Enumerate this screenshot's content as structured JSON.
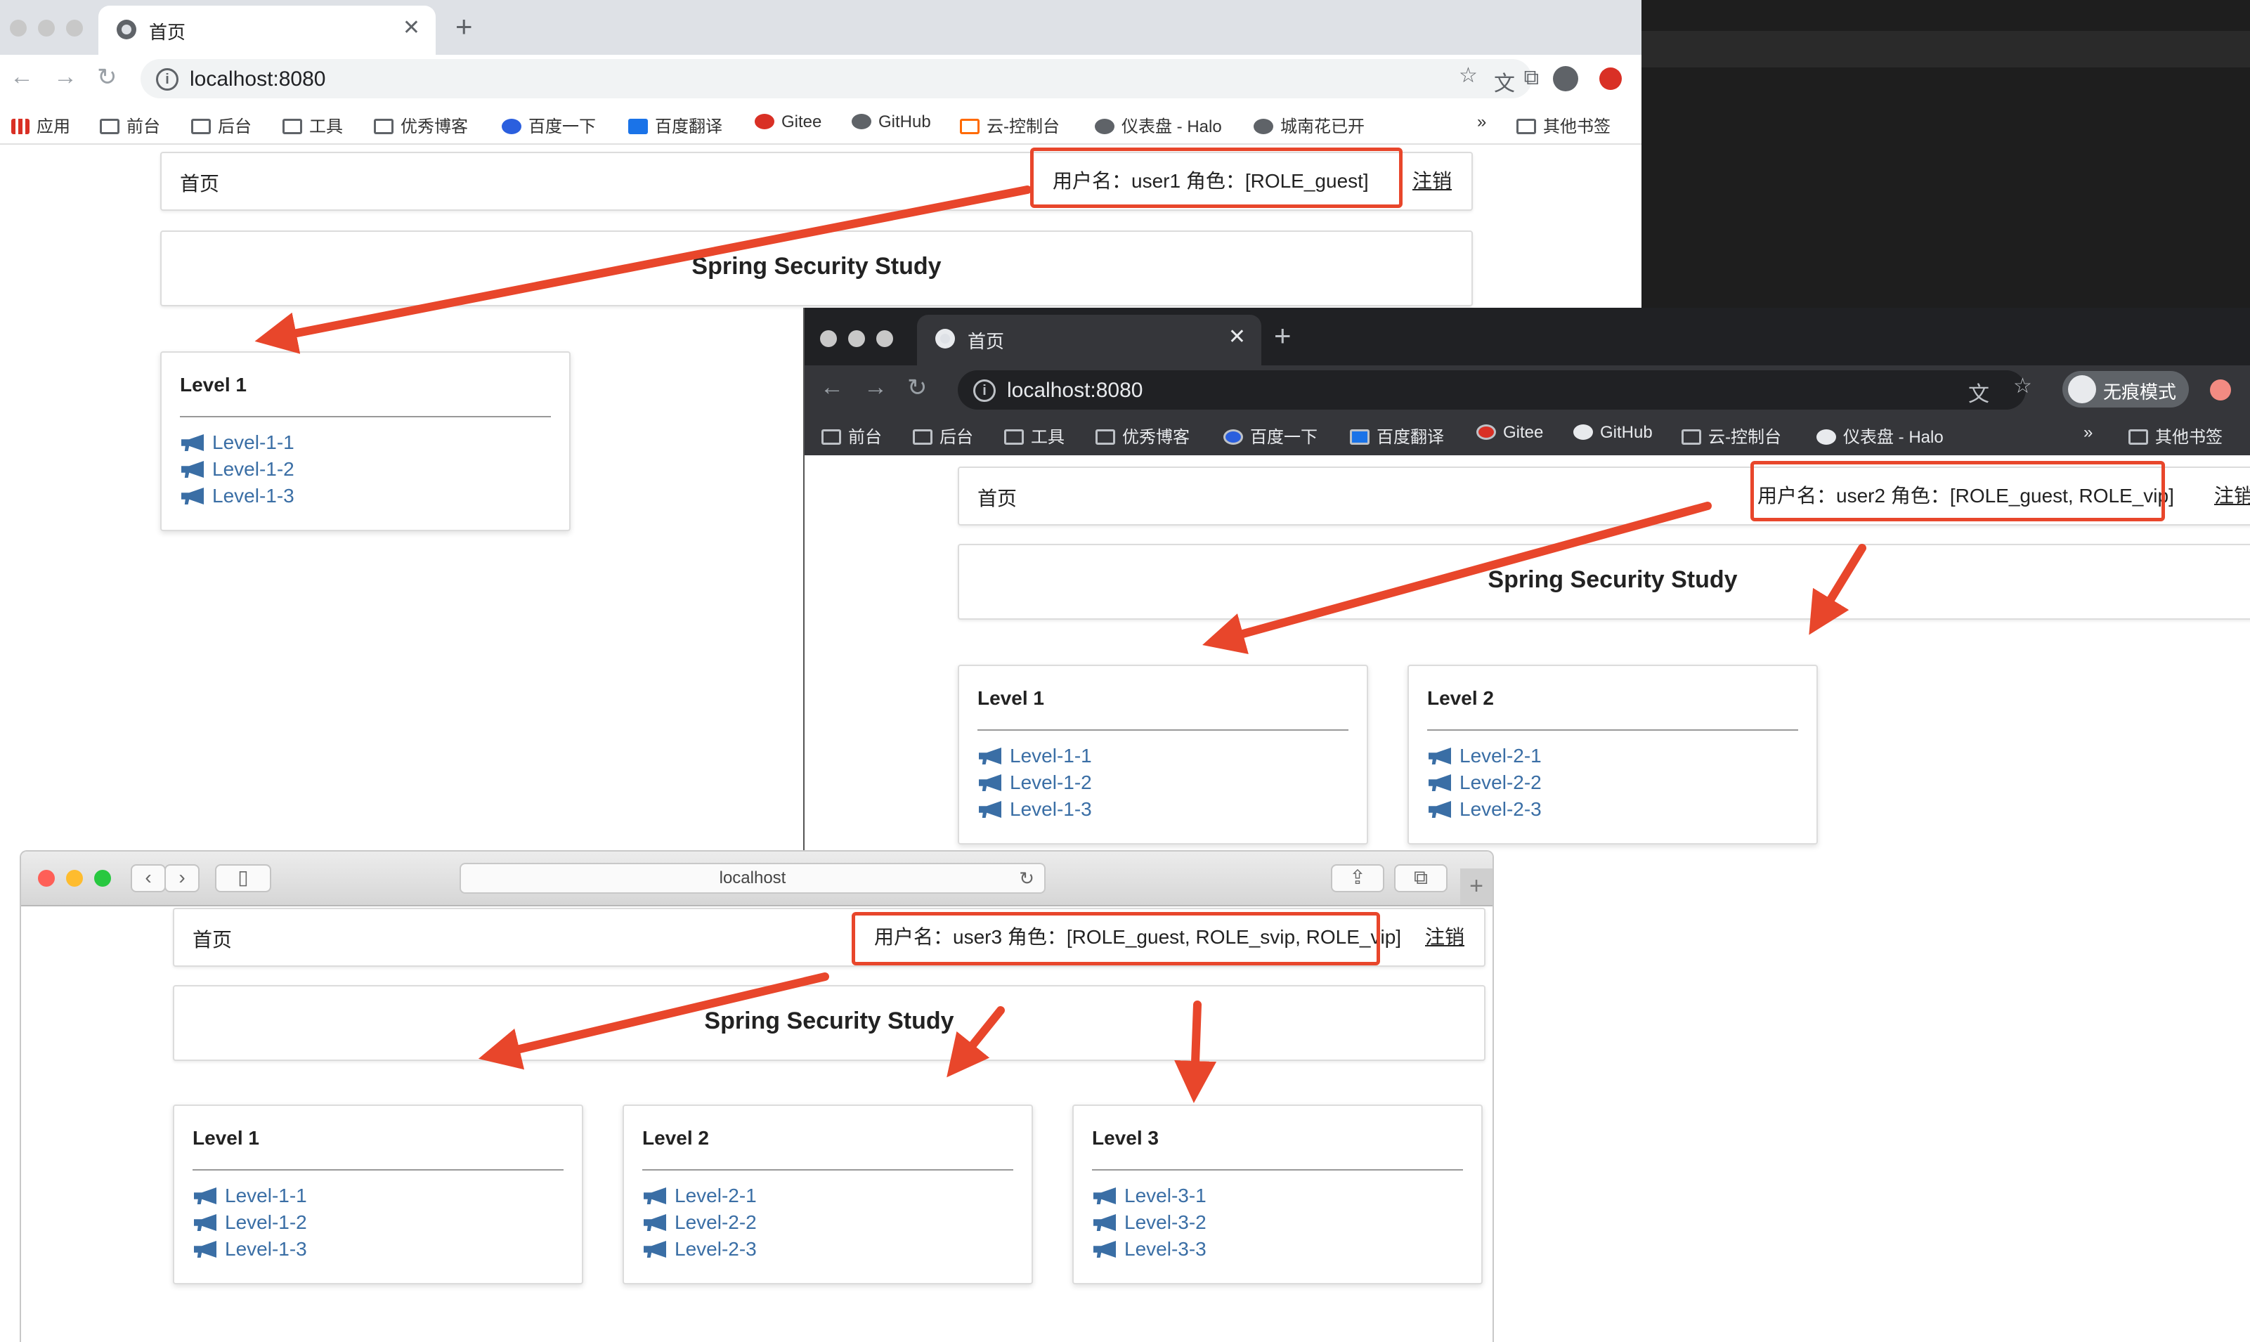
{
  "windows": {
    "w1": {
      "tab_title": "首页",
      "url": "localhost:8080",
      "bookmarks": [
        "应用",
        "前台",
        "后台",
        "工具",
        "优秀博客",
        "百度一下",
        "百度翻译",
        "Gitee",
        "GitHub",
        "云-控制台",
        "仪表盘 - Halo",
        "城南花已开",
        "»",
        "其他书签"
      ],
      "page": {
        "home": "首页",
        "user_info": "用户名：user1 角色：[ROLE_guest]",
        "logout": "注销",
        "title": "Spring Security Study",
        "cards": [
          {
            "title": "Level 1",
            "links": [
              "Level-1-1",
              "Level-1-2",
              "Level-1-3"
            ]
          }
        ]
      }
    },
    "w2": {
      "tab_title": "首页",
      "url": "localhost:8080",
      "incognito_label": "无痕模式",
      "bookmarks": [
        "前台",
        "后台",
        "工具",
        "优秀博客",
        "百度一下",
        "百度翻译",
        "Gitee",
        "GitHub",
        "云-控制台",
        "仪表盘 - Halo",
        "»",
        "其他书签"
      ],
      "page": {
        "home": "首页",
        "user_info": "用户名：user2 角色：[ROLE_guest, ROLE_vip]",
        "logout": "注销",
        "title": "Spring Security Study",
        "cards": [
          {
            "title": "Level 1",
            "links": [
              "Level-1-1",
              "Level-1-2",
              "Level-1-3"
            ]
          },
          {
            "title": "Level 2",
            "links": [
              "Level-2-1",
              "Level-2-2",
              "Level-2-3"
            ]
          }
        ]
      }
    },
    "w3": {
      "url": "localhost",
      "page": {
        "home": "首页",
        "user_info": "用户名：user3 角色：[ROLE_guest, ROLE_svip, ROLE_vip]",
        "logout": "注销",
        "title": "Spring Security Study",
        "cards": [
          {
            "title": "Level 1",
            "links": [
              "Level-1-1",
              "Level-1-2",
              "Level-1-3"
            ]
          },
          {
            "title": "Level 2",
            "links": [
              "Level-2-1",
              "Level-2-2",
              "Level-2-3"
            ]
          },
          {
            "title": "Level 3",
            "links": [
              "Level-3-1",
              "Level-3-2",
              "Level-3-3"
            ]
          }
        ]
      }
    }
  },
  "colors": {
    "annotation_red": "#e8462b",
    "link_blue": "#3a6ea5"
  },
  "icons": {
    "link_icon": "bullhorn-icon",
    "tab_icon": "globe-icon"
  }
}
